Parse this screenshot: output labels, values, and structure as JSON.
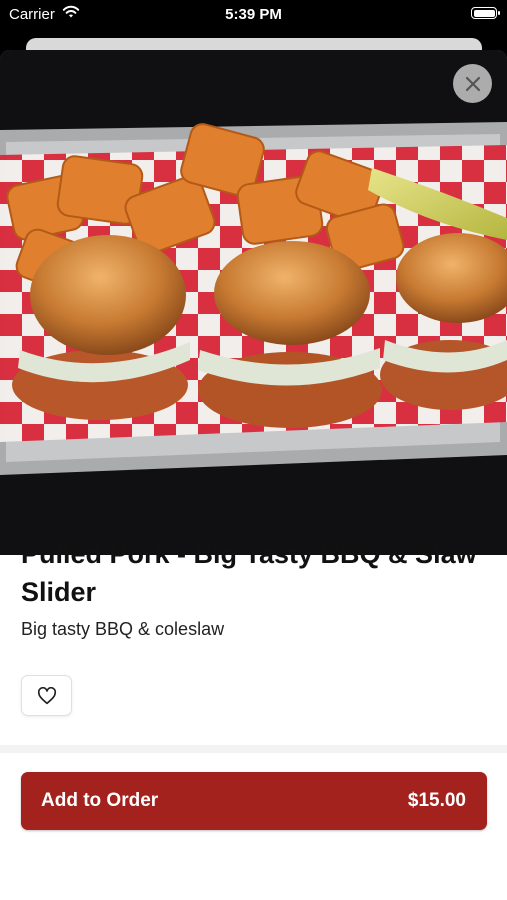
{
  "status_bar": {
    "carrier": "Carrier",
    "time": "5:39 PM"
  },
  "item": {
    "title": "Pulled Pork - Big Tasty BBQ & Slaw Slider",
    "description": "Big tasty BBQ & coleslaw",
    "image_alt": "Pulled pork sliders with coleslaw and waffle fries on a tray"
  },
  "actions": {
    "add_to_order_label": "Add to Order",
    "price": "$15.00"
  },
  "icons": {
    "close": "close-icon",
    "favorite": "heart-icon",
    "wifi": "wifi-icon",
    "battery": "battery-icon"
  },
  "colors": {
    "accent": "#a3221d",
    "close_button_bg": "#c8c8c8"
  }
}
